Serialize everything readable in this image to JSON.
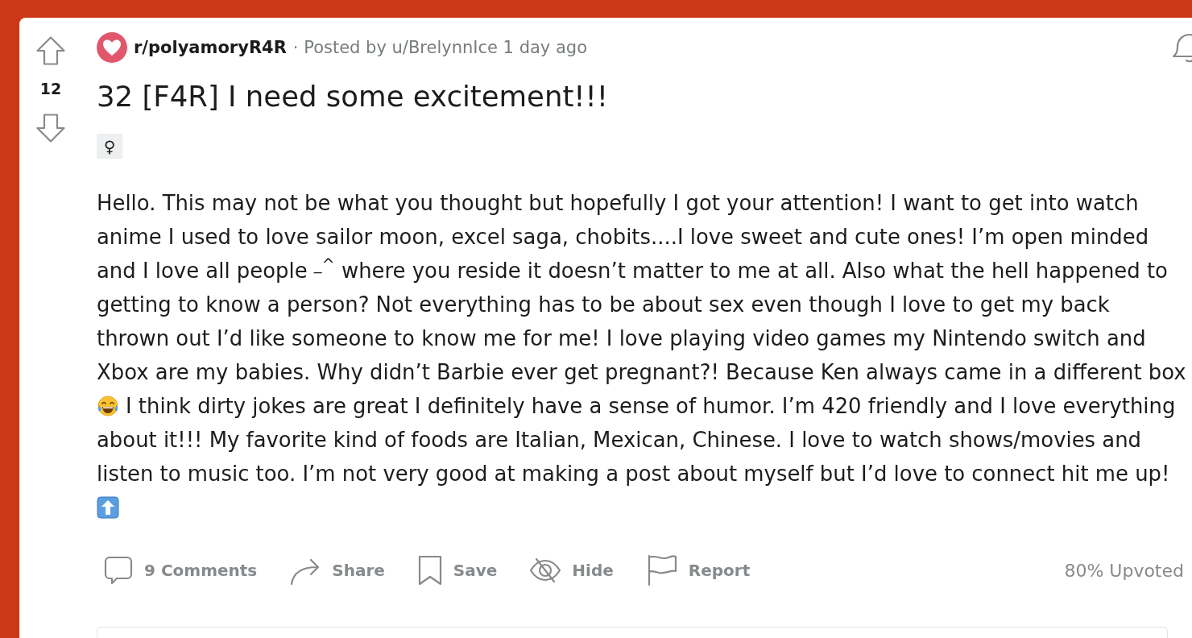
{
  "post": {
    "score": "12",
    "subreddit": "r/polyamoryR4R",
    "meta": "· Posted by u/BrelynnIce 1 day ago",
    "title": "32 [F4R] I need some excitement!!!",
    "flair": "♀",
    "body": [
      {
        "kind": "text",
        "text": "Hello. This may not be what you thought but hopefully I got your attention! I want to get into watch anime I used to love sailor moon, excel saga, chobits....I love sweet and cute ones! I’m open minded and I love all people $^{_^}$ where you reside it doesn’t matter to me at all. Also what the hell happened to getting to know a person? Not everything has to be about sex even though I love to get my back thrown out I’d like someone to know me for me! I love playing video games my Nintendo switch and Xbox are my babies. Why didn’t Barbie ever get pregnant?! Because Ken always came in a different box"
      },
      {
        "kind": "laugh"
      },
      {
        "kind": "text",
        "text": "I think dirty jokes are great I definitely have a sense of humor. I’m 420 friendly and I love everything about it!!! My favorite kind of foods are Italian, Mexican, Chinese. I love to watch shows/movies and listen to music too. I’m not very good at making a post about myself but I’d love to connect hit me up!"
      },
      {
        "kind": "uparrow"
      }
    ],
    "actions": [
      {
        "kind": "comments",
        "label": "9 Comments"
      },
      {
        "kind": "share",
        "label": "Share"
      },
      {
        "kind": "save",
        "label": "Save"
      },
      {
        "kind": "hide",
        "label": "Hide"
      },
      {
        "kind": "report",
        "label": "Report"
      }
    ],
    "upvote_ratio": "80% Upvoted"
  }
}
